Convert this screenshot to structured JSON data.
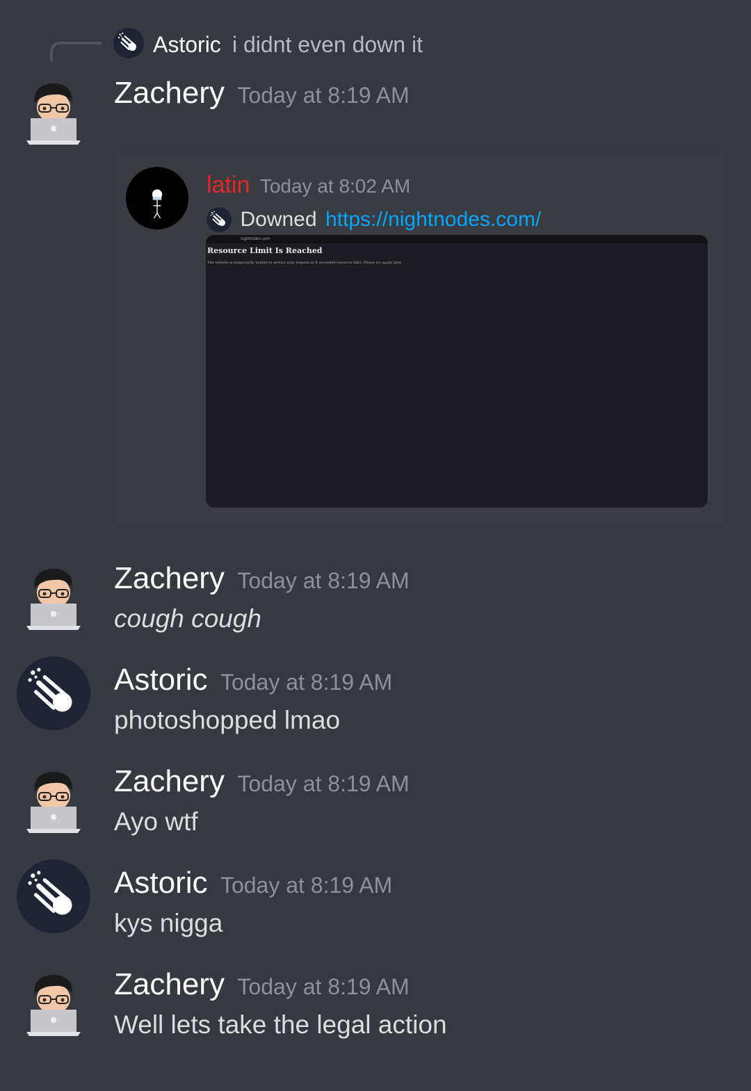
{
  "reply": {
    "author": "Astoric",
    "text": "i didnt even down it"
  },
  "messages": [
    {
      "author": "Zachery",
      "time": "Today at 8:19 AM",
      "embed": {
        "author": "latin",
        "time": "Today at 8:02 AM",
        "text": "Downed",
        "link": "https://nightnodes.com/",
        "screenshot": {
          "url_bar": "nightnodes.com",
          "title": "Resource Limit Is Reached",
          "body": "The website is temporarily unable to service your request as it exceeded resource limit. Please try again later."
        }
      }
    },
    {
      "author": "Zachery",
      "time": "Today at 8:19 AM",
      "content": "cough cough"
    },
    {
      "author": "Astoric",
      "time": "Today at 8:19 AM",
      "content": "photoshopped lmao"
    },
    {
      "author": "Zachery",
      "time": "Today at 8:19 AM",
      "content": "Ayo wtf"
    },
    {
      "author": "Astoric",
      "time": "Today at 8:19 AM",
      "content": "kys nigga"
    },
    {
      "author": "Zachery",
      "time": "Today at 8:19 AM",
      "content": "Well lets take the legal action"
    }
  ],
  "colors": {
    "background": "#36393f",
    "embed_author": "#e02626",
    "link": "#00a8fc",
    "timestamp": "#8e9297"
  },
  "icons": {
    "astoric_avatar": "comet-icon",
    "zachery_avatar": "memoji-laptop-icon",
    "latin_avatar": "stick-figure-icon"
  }
}
